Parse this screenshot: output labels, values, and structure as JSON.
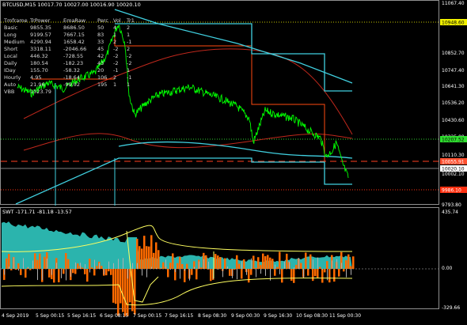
{
  "main_chart": {
    "header": "BTCUSD,M15  10017.70 10027.00 10016.90 10020.10",
    "price_axis": [
      "11067.40",
      "10852.70",
      "10747.40",
      "10641.30",
      "10536.20",
      "10430.60",
      "10325.00",
      "10110.30",
      "10002.10",
      "9793.80"
    ],
    "price_tags": [
      {
        "label": "10948.60",
        "color": "#f0f000",
        "text_color": "#000000"
      },
      {
        "label": "10207.52",
        "color": "#30e030",
        "text_color": "#000000"
      },
      {
        "label": "10055.91",
        "color": "#ff5030",
        "text_color": "#ffffff"
      },
      {
        "label": "10020.10",
        "color": "#ffffff",
        "text_color": "#000000"
      },
      {
        "label": "9986.10",
        "color": "#ff3010",
        "text_color": "#ffffff"
      }
    ],
    "table": {
      "headers": [
        "Tmframe",
        "TrPower",
        "EmaRaw",
        "Perc",
        "Vol",
        "Tr1"
      ],
      "rows": [
        [
          "Basic",
          "9855.35",
          "8686.50",
          "50",
          "4",
          "2"
        ],
        [
          "Long",
          "9199.57",
          "7667.15",
          "83",
          "1",
          "1"
        ],
        [
          "Medium",
          "4290.94",
          "1658.42",
          "33",
          "2",
          "-1"
        ],
        [
          "Short",
          "3318.11",
          "-2046.66",
          "45",
          "-2",
          "2"
        ],
        [
          "Local",
          "446.32",
          "-728.55",
          "42",
          "-2",
          "-2"
        ],
        [
          "Daily",
          "180.54",
          "-182.23",
          "43",
          "-2",
          "-2"
        ],
        [
          "IDay",
          "155.70",
          "-58.32",
          "20",
          "-1",
          "1"
        ],
        [
          "Hourly",
          "4.95",
          "-18.64",
          "106",
          "2",
          "-1"
        ],
        [
          "Auto",
          "21.96",
          "-99.02",
          "195",
          "1",
          "1"
        ],
        [
          "VBB",
          "1023.79",
          "",
          "",
          "",
          ""
        ]
      ]
    }
  },
  "indicator": {
    "header": "SWT -171.71 -81.18 -13.57",
    "axis": [
      "435.74",
      "0.00",
      "-329.66"
    ]
  },
  "time_axis": [
    "4 Sep 2019",
    "5 Sep 00:15",
    "5 Sep 16:15",
    "6 Sep 08:15",
    "7 Sep 00:15",
    "7 Sep 16:15",
    "8 Sep 08:30",
    "9 Sep 00:30",
    "9 Sep 16:30",
    "10 Sep 08:30",
    "11 Sep 00:30"
  ],
  "colors": {
    "price_line": "#00ff00",
    "cyan_band": "#40d0e0",
    "red_envelope": "#c0281c",
    "orange_box": "#ff4a10",
    "yellow_line": "#ffff60",
    "teal_fill": "#30c8c0",
    "orange_fill": "#ff6a00"
  }
}
